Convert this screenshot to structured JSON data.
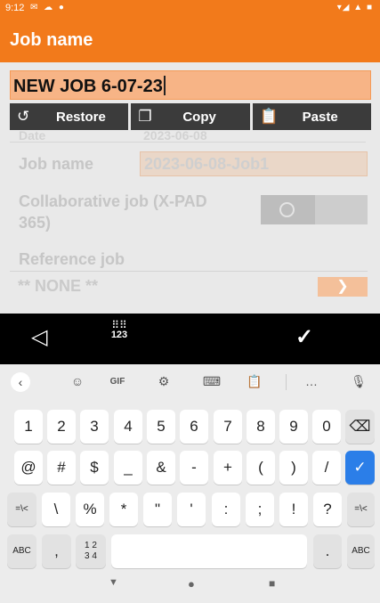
{
  "status_bar": {
    "time": "9:12"
  },
  "header": {
    "title": "Job name"
  },
  "edit_field": {
    "value": "NEW JOB 6-07-23"
  },
  "popup": {
    "restore": "Restore",
    "copy": "Copy",
    "paste": "Paste"
  },
  "form_behind": {
    "row0_label": "Date",
    "row0_value": "2023-06-08",
    "job_name_label": "Job name",
    "job_name_value": "2023-06-08-Job1",
    "collab_label_line1": "Collaborative job (X-PAD",
    "collab_label_line2": "365)",
    "reference_label": "Reference job",
    "reference_value": "** NONE **"
  },
  "key_toolbar": {
    "numpad_label": "123"
  },
  "keyboard": {
    "suggestion_bar": {
      "gif": "GIF",
      "more": "…"
    },
    "row1": [
      "1",
      "2",
      "3",
      "4",
      "5",
      "6",
      "7",
      "8",
      "9",
      "0"
    ],
    "row2": [
      "@",
      "#",
      "$",
      "_",
      "&",
      "-",
      "+",
      "(",
      ")",
      "/"
    ],
    "row3": [
      "=\\<",
      "\\",
      "%",
      "*",
      "\"",
      "'",
      ":",
      ";",
      "!",
      "?",
      "=\\<"
    ],
    "row4": {
      "abc_left": "ABC",
      "comma": ",",
      "fraction": "1 2\n3 4",
      "period": ".",
      "abc_right": "ABC"
    }
  },
  "colors": {
    "accent": "#f27a1b",
    "field": "#f7b486",
    "enter_key": "#2b7ee8"
  }
}
